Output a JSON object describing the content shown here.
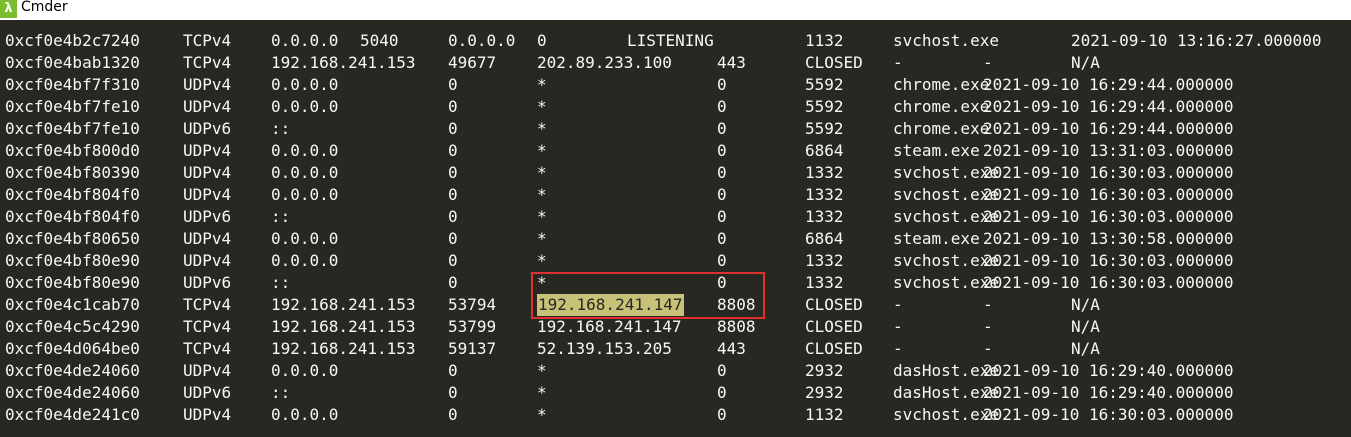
{
  "window": {
    "title": "Cmder",
    "icon": "lambda-icon",
    "icon_glyph": "λ"
  },
  "colors": {
    "background": "#272822",
    "text": "#f8f8f2",
    "highlight": "#c7c278",
    "box": "#e03131"
  },
  "rows": [
    {
      "offset": "0xcf0e4b2c7240",
      "proto": "TCPv4",
      "laddr": "0.0.0.0",
      "lport": "5040",
      "faddr": "0.0.0.0",
      "fport": "0",
      "state": "LISTENING",
      "pid": "1132",
      "owner": "svchost.exe",
      "created": "2021-09-10 13:16:27.000000"
    },
    {
      "offset": "0xcf0e4bab1320",
      "proto": "TCPv4",
      "laddr": "192.168.241.153",
      "lport": "49677",
      "faddr": "202.89.233.100",
      "fport": "443",
      "state": "CLOSED",
      "pid": "-",
      "owner": "-",
      "created": "N/A"
    },
    {
      "offset": "0xcf0e4bf7f310",
      "proto": "UDPv4",
      "laddr": "0.0.0.0",
      "lport": "0",
      "faddr": "*",
      "fport": "0",
      "state": "",
      "pid": "5592",
      "owner": "chrome.exe",
      "created": "2021-09-10 16:29:44.000000"
    },
    {
      "offset": "0xcf0e4bf7fe10",
      "proto": "UDPv4",
      "laddr": "0.0.0.0",
      "lport": "0",
      "faddr": "*",
      "fport": "0",
      "state": "",
      "pid": "5592",
      "owner": "chrome.exe",
      "created": "2021-09-10 16:29:44.000000"
    },
    {
      "offset": "0xcf0e4bf7fe10",
      "proto": "UDPv6",
      "laddr": "::",
      "lport": "0",
      "faddr": "*",
      "fport": "0",
      "state": "",
      "pid": "5592",
      "owner": "chrome.exe",
      "created": "2021-09-10 16:29:44.000000"
    },
    {
      "offset": "0xcf0e4bf800d0",
      "proto": "UDPv4",
      "laddr": "0.0.0.0",
      "lport": "0",
      "faddr": "*",
      "fport": "0",
      "state": "",
      "pid": "6864",
      "owner": "steam.exe",
      "created": "2021-09-10 13:31:03.000000"
    },
    {
      "offset": "0xcf0e4bf80390",
      "proto": "UDPv4",
      "laddr": "0.0.0.0",
      "lport": "0",
      "faddr": "*",
      "fport": "0",
      "state": "",
      "pid": "1332",
      "owner": "svchost.exe",
      "created": "2021-09-10 16:30:03.000000"
    },
    {
      "offset": "0xcf0e4bf804f0",
      "proto": "UDPv4",
      "laddr": "0.0.0.0",
      "lport": "0",
      "faddr": "*",
      "fport": "0",
      "state": "",
      "pid": "1332",
      "owner": "svchost.exe",
      "created": "2021-09-10 16:30:03.000000"
    },
    {
      "offset": "0xcf0e4bf804f0",
      "proto": "UDPv6",
      "laddr": "::",
      "lport": "0",
      "faddr": "*",
      "fport": "0",
      "state": "",
      "pid": "1332",
      "owner": "svchost.exe",
      "created": "2021-09-10 16:30:03.000000"
    },
    {
      "offset": "0xcf0e4bf80650",
      "proto": "UDPv4",
      "laddr": "0.0.0.0",
      "lport": "0",
      "faddr": "*",
      "fport": "0",
      "state": "",
      "pid": "6864",
      "owner": "steam.exe",
      "created": "2021-09-10 13:30:58.000000"
    },
    {
      "offset": "0xcf0e4bf80e90",
      "proto": "UDPv4",
      "laddr": "0.0.0.0",
      "lport": "0",
      "faddr": "*",
      "fport": "0",
      "state": "",
      "pid": "1332",
      "owner": "svchost.exe",
      "created": "2021-09-10 16:30:03.000000"
    },
    {
      "offset": "0xcf0e4bf80e90",
      "proto": "UDPv6",
      "laddr": "::",
      "lport": "0",
      "faddr": "*",
      "fport": "0",
      "state": "",
      "pid": "1332",
      "owner": "svchost.exe",
      "created": "2021-09-10 16:30:03.000000"
    },
    {
      "offset": "0xcf0e4c1cab70",
      "proto": "TCPv4",
      "laddr": "192.168.241.153",
      "lport": "53794",
      "faddr": "192.168.241.147",
      "fport": "8808",
      "state": "CLOSED",
      "pid": "-",
      "owner": "-",
      "created": "N/A",
      "highlight": true
    },
    {
      "offset": "0xcf0e4c5c4290",
      "proto": "TCPv4",
      "laddr": "192.168.241.153",
      "lport": "53799",
      "faddr": "192.168.241.147",
      "fport": "8808",
      "state": "CLOSED",
      "pid": "-",
      "owner": "-",
      "created": "N/A"
    },
    {
      "offset": "0xcf0e4d064be0",
      "proto": "TCPv4",
      "laddr": "192.168.241.153",
      "lport": "59137",
      "faddr": "52.139.153.205",
      "fport": "443",
      "state": "CLOSED",
      "pid": "-",
      "owner": "-",
      "created": "N/A"
    },
    {
      "offset": "0xcf0e4de24060",
      "proto": "UDPv4",
      "laddr": "0.0.0.0",
      "lport": "0",
      "faddr": "*",
      "fport": "0",
      "state": "",
      "pid": "2932",
      "owner": "dasHost.exe",
      "created": "2021-09-10 16:29:40.000000"
    },
    {
      "offset": "0xcf0e4de24060",
      "proto": "UDPv6",
      "laddr": "::",
      "lport": "0",
      "faddr": "*",
      "fport": "0",
      "state": "",
      "pid": "2932",
      "owner": "dasHost.exe",
      "created": "2021-09-10 16:29:40.000000"
    },
    {
      "offset": "0xcf0e4de241c0",
      "proto": "UDPv4",
      "laddr": "0.0.0.0",
      "lport": "0",
      "faddr": "*",
      "fport": "0",
      "state": "",
      "pid": "1132",
      "owner": "svchost.exe",
      "created": "2021-09-10 16:30:03.000000"
    }
  ]
}
